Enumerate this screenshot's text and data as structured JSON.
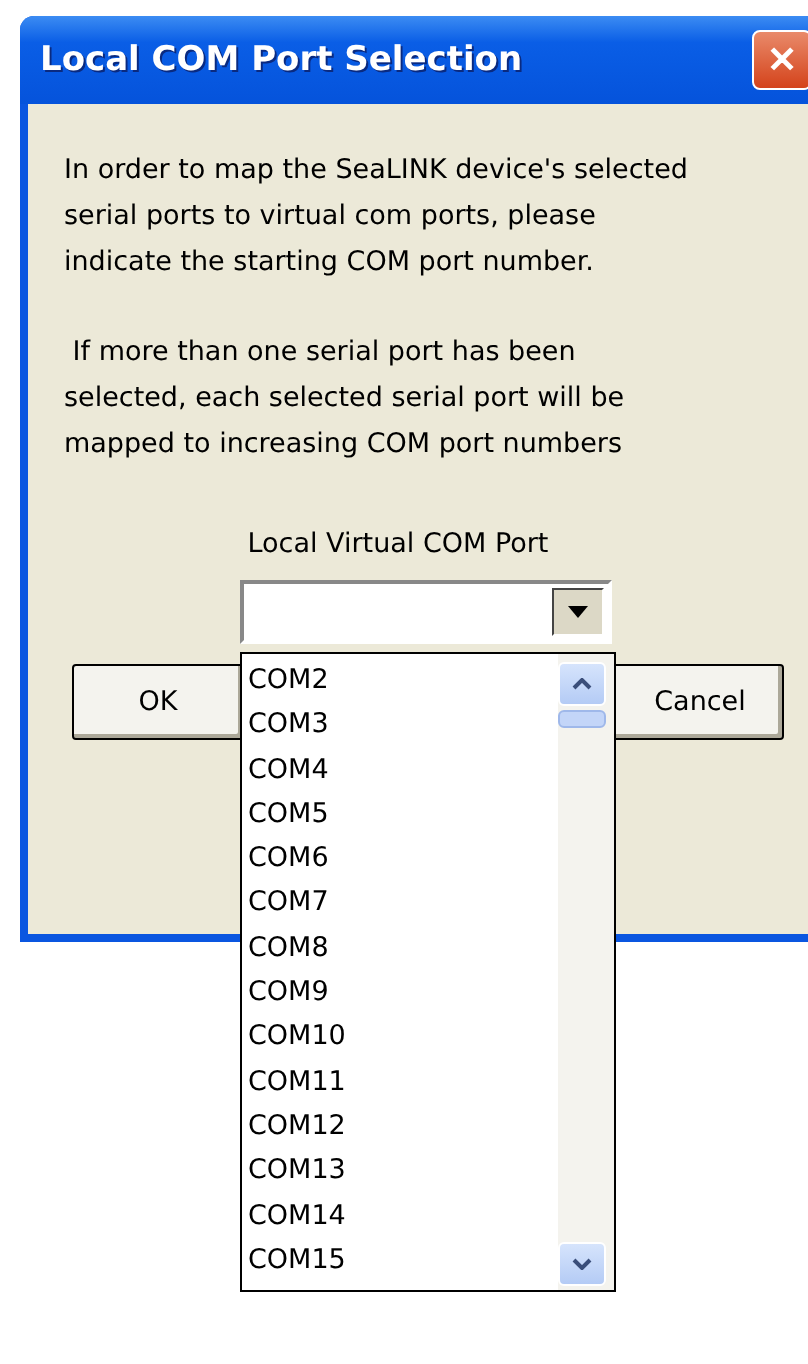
{
  "window": {
    "title": "Local COM Port Selection",
    "close": "✕"
  },
  "message": [
    "In order to map the SeaLINK device's selected serial ports to virtual com ports, please indicate the starting COM port number.",
    " If more than one serial port has been selected, each selected serial port will be mapped to increasing COM port numbers"
  ],
  "combo": {
    "label": "Local Virtual COM Port",
    "expanded": true,
    "options": [
      {
        "label": "COM2",
        "selected": false
      },
      {
        "label": "COM3",
        "selected": false
      },
      {
        "label": "COM4",
        "selected": false
      },
      {
        "label": "COM5",
        "selected": false
      },
      {
        "label": "COM6",
        "selected": false
      },
      {
        "label": "COM7",
        "selected": false
      },
      {
        "label": "COM8",
        "selected": false
      },
      {
        "label": "COM9",
        "selected": false
      },
      {
        "label": "COM10",
        "selected": false
      },
      {
        "label": "COM11",
        "selected": false
      },
      {
        "label": "COM12",
        "selected": false
      },
      {
        "label": "COM13",
        "selected": false
      },
      {
        "label": "COM14",
        "selected": false
      },
      {
        "label": "COM15",
        "selected": false
      }
    ]
  },
  "buttons": [
    "OK",
    "Cancel"
  ]
}
